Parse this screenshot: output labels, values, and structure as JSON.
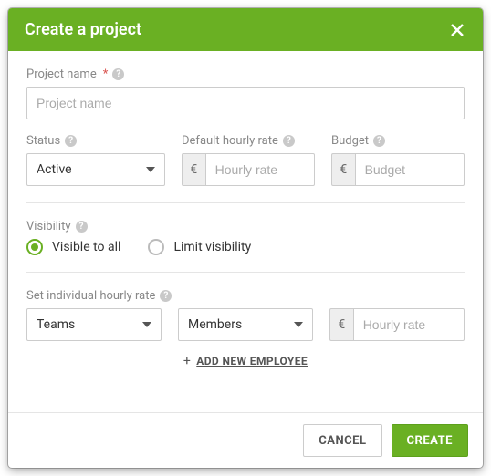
{
  "header": {
    "title": "Create a project"
  },
  "project_name": {
    "label": "Project name",
    "required_mark": "*",
    "placeholder": "Project name"
  },
  "status": {
    "label": "Status",
    "value": "Active"
  },
  "default_rate": {
    "label": "Default hourly rate",
    "currency": "€",
    "placeholder": "Hourly rate"
  },
  "budget": {
    "label": "Budget",
    "currency": "€",
    "placeholder": "Budget"
  },
  "visibility": {
    "label": "Visibility",
    "options": [
      {
        "label": "Visible to all",
        "selected": true
      },
      {
        "label": "Limit visibility",
        "selected": false
      }
    ]
  },
  "individual_rate": {
    "label": "Set individual hourly rate",
    "teams_value": "Teams",
    "members_value": "Members",
    "currency": "€",
    "rate_placeholder": "Hourly rate",
    "add_label": "ADD NEW EMPLOYEE"
  },
  "footer": {
    "cancel": "CANCEL",
    "create": "CREATE"
  },
  "help_glyph": "?"
}
